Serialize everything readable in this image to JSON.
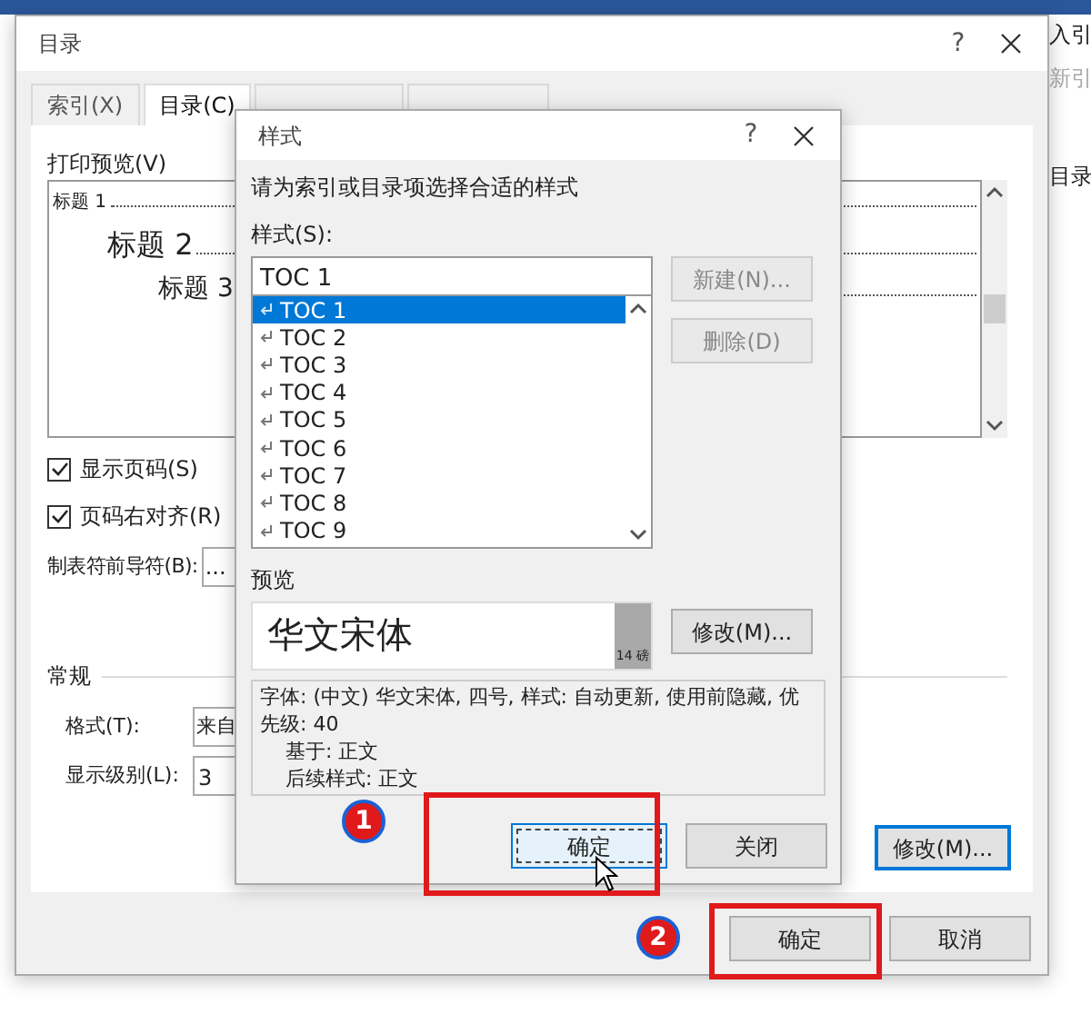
{
  "ribbon": {
    "items": [
      {
        "label": "入引",
        "disabled": false
      },
      {
        "label": "新引",
        "disabled": true
      },
      {
        "label": "目录",
        "disabled": false
      }
    ]
  },
  "toc_dialog": {
    "title": "目录",
    "help": "?",
    "tabs": [
      {
        "label": "索引(X)",
        "selected": false
      },
      {
        "label": "目录(C)",
        "selected": true
      },
      {
        "selected": false
      },
      {
        "selected": false
      }
    ],
    "preview_label": "打印预览(V)",
    "preview_lines": [
      {
        "text": "标题 1",
        "children": [
          {
            "text": "标题 2",
            "children": [
              {
                "text": "标题 3"
              }
            ]
          }
        ]
      }
    ],
    "checkboxes": [
      {
        "label": "显示页码(S)",
        "checked": true
      },
      {
        "label": "页码右对齐(R)",
        "checked": true
      }
    ],
    "leader": {
      "label": "制表符前导符(B):",
      "value": "..."
    },
    "general_label": "常规",
    "format": {
      "label": "格式(T):",
      "value": "来自"
    },
    "show_level": {
      "label": "显示级别(L):",
      "value": "3"
    },
    "modify_button": {
      "label": "修改(M)...",
      "focused": true
    },
    "buttons": [
      {
        "label": "确定",
        "focused": false
      },
      {
        "label": "取消",
        "focused": false
      }
    ]
  },
  "style_dialog": {
    "title": "样式",
    "help": "?",
    "instruction": "请为索引或目录项选择合适的样式",
    "style_label": "样式(S):",
    "style_value": "TOC 1",
    "styles": [
      {
        "label": "TOC 1",
        "selected": true
      },
      {
        "label": "TOC 2",
        "selected": false
      },
      {
        "label": "TOC 3",
        "selected": false
      },
      {
        "label": "TOC 4",
        "selected": false
      },
      {
        "label": "TOC 5",
        "selected": false
      },
      {
        "label": "TOC 6",
        "selected": false
      },
      {
        "label": "TOC 7",
        "selected": false
      },
      {
        "label": "TOC 8",
        "selected": false
      },
      {
        "label": "TOC 9",
        "selected": false
      }
    ],
    "side_buttons": [
      {
        "label": "新建(N)...",
        "disabled": true
      },
      {
        "label": "删除(D)",
        "disabled": true
      }
    ],
    "preview_label": "预览",
    "preview_text": "华文宋体",
    "preview_size": "14 磅",
    "modify_button": {
      "label": "修改(M)...",
      "disabled": false
    },
    "description": [
      "字体: (中文) 华文宋体, 四号, 样式: 自动更新, 使用前隐藏, 优先级: 40",
      "基于: 正文",
      "后续样式: 正文"
    ],
    "buttons": [
      {
        "label": "确定",
        "focused": true
      },
      {
        "label": "关闭",
        "focused": false
      }
    ]
  },
  "annotations": [
    {
      "label": "1"
    },
    {
      "label": "2"
    }
  ]
}
